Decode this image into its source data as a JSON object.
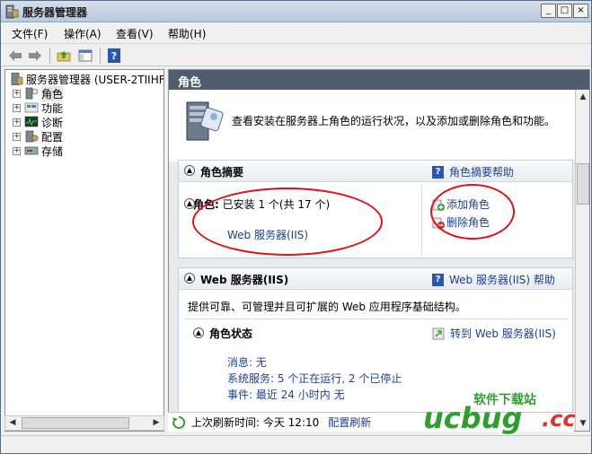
{
  "window": {
    "title": "服务器管理器",
    "controls": [
      "_",
      "□",
      "×"
    ]
  },
  "menu": [
    "文件(F)",
    "操作(A)",
    "查看(V)",
    "帮助(H)"
  ],
  "tree": {
    "root": "服务器管理器 (USER-2TIIHF",
    "items": [
      "角色",
      "功能",
      "诊断",
      "配置",
      "存储"
    ]
  },
  "main": {
    "header": "角色",
    "intro": "查看安装在服务器上角色的运行状况，以及添加或删除角色和功能。",
    "summary": {
      "title": "角色摘要",
      "help": "角色摘要帮助",
      "roles_label": "角色:",
      "roles_value": "已安装 1 个(共 17 个)",
      "role_link": "Web 服务器(IIS)",
      "add_role": "添加角色",
      "remove_role": "删除角色"
    },
    "web": {
      "title": "Web 服务器(IIS)",
      "help": "Web 服务器(IIS) 帮助",
      "description": "提供可靠、可管理并且可扩展的 Web 应用程序基础结构。",
      "status_title": "角色状态",
      "goto": "转到 Web 服务器(IIS)",
      "messages": "消息: 无",
      "services": "系统服务: 5 个正在运行, 2 个已停止",
      "events": "事件: 最近 24 小时内 无"
    }
  },
  "status": {
    "last_refresh": "上次刷新时间: 今天 12:10",
    "configure": "配置刷新"
  },
  "watermark": {
    "line1": "软件下载站",
    "brand": "ucbug",
    "suffix": ".cc"
  },
  "colors": {
    "accent_link": "#1c3f9b",
    "header_bg": "#4f5d6e",
    "annotation": "#e01010",
    "watermark_green": "#2f9e2f",
    "watermark_red": "#e03030"
  }
}
